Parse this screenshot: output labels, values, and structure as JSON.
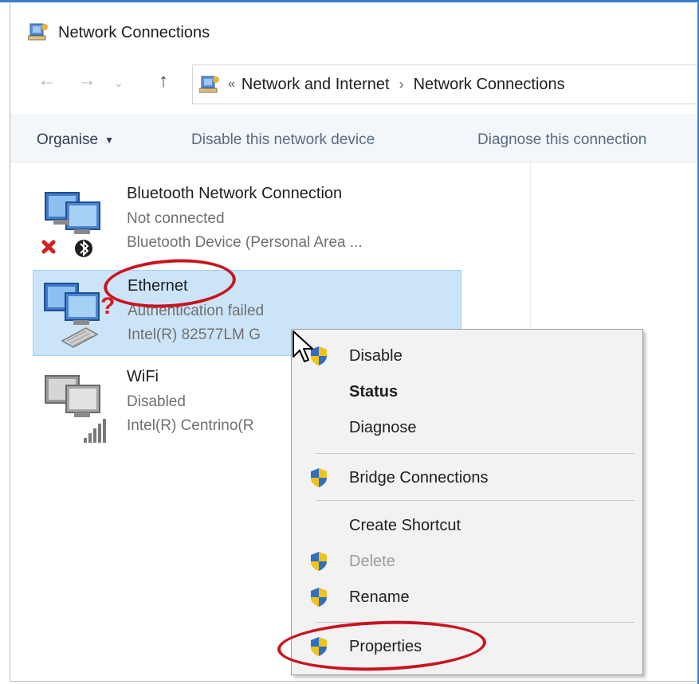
{
  "window": {
    "title": "Network Connections"
  },
  "address": {
    "overflow": "«",
    "crumbs": [
      "Network and Internet",
      "Network Connections"
    ],
    "separator": "›"
  },
  "nav": {
    "back": "←",
    "forward": "→",
    "recent": "⌄",
    "up": "↑"
  },
  "toolbar": {
    "organise": "Organise",
    "organise_caret": "▼",
    "disable_device": "Disable this network device",
    "diagnose": "Diagnose this connection"
  },
  "connections": [
    {
      "name": "Bluetooth Network Connection",
      "status": "Not connected",
      "device": "Bluetooth Device (Personal Area ...",
      "icon": "bluetooth-network-icon",
      "overlay": "red-x-icon"
    },
    {
      "name": "Ethernet",
      "status": "Authentication failed",
      "device": "Intel(R) 82577LM G",
      "icon": "ethernet-network-icon",
      "overlay": "question-mark-icon",
      "selected": true
    },
    {
      "name": "WiFi",
      "status": "Disabled",
      "device": "Intel(R) Centrino(R",
      "icon": "wifi-network-icon",
      "overlay": "signal-bars-icon"
    }
  ],
  "context_menu": {
    "items": [
      {
        "label": "Disable",
        "shield": true,
        "bold": false,
        "disabled": false
      },
      {
        "label": "Status",
        "shield": false,
        "bold": true,
        "disabled": false
      },
      {
        "label": "Diagnose",
        "shield": false,
        "bold": false,
        "disabled": false
      },
      {
        "label": "Bridge Connections",
        "shield": true,
        "bold": false,
        "disabled": false
      },
      {
        "label": "Create Shortcut",
        "shield": false,
        "bold": false,
        "disabled": false
      },
      {
        "label": "Delete",
        "shield": true,
        "bold": false,
        "disabled": true
      },
      {
        "label": "Rename",
        "shield": true,
        "bold": false,
        "disabled": false
      },
      {
        "label": "Properties",
        "shield": true,
        "bold": false,
        "disabled": false
      }
    ]
  },
  "colors": {
    "selection_bg": "#cce4f7",
    "selection_border": "#99d1ff",
    "annotation_red": "#c8141e",
    "menu_bg": "#f2f2f2",
    "command_bar_text": "#5a6b82"
  }
}
